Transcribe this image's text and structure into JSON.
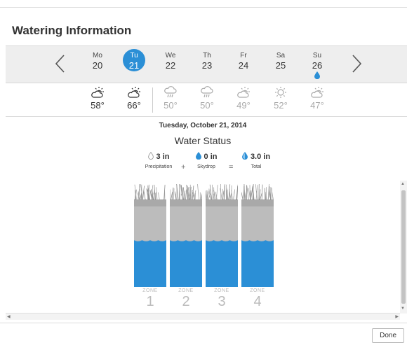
{
  "header": {
    "title": "Watering Information"
  },
  "days": [
    {
      "name": "Mo",
      "num": "20",
      "selected": false,
      "water": false
    },
    {
      "name": "Tu",
      "num": "21",
      "selected": true,
      "water": false
    },
    {
      "name": "We",
      "num": "22",
      "selected": false,
      "water": false
    },
    {
      "name": "Th",
      "num": "23",
      "selected": false,
      "water": false
    },
    {
      "name": "Fr",
      "num": "24",
      "selected": false,
      "water": false
    },
    {
      "name": "Sa",
      "num": "25",
      "selected": false,
      "water": false
    },
    {
      "name": "Su",
      "num": "26",
      "selected": false,
      "water": true
    }
  ],
  "forecast": [
    {
      "icon": "partly-sunny-icon",
      "temp": "58°",
      "past": true
    },
    {
      "icon": "partly-sunny-icon",
      "temp": "66°",
      "past": true
    },
    {
      "icon": "rain-icon",
      "temp": "50°",
      "past": false
    },
    {
      "icon": "rain-icon",
      "temp": "50°",
      "past": false
    },
    {
      "icon": "partly-sunny-icon",
      "temp": "49°",
      "past": false
    },
    {
      "icon": "sunny-icon",
      "temp": "52°",
      "past": false
    },
    {
      "icon": "partly-sunny-icon",
      "temp": "47°",
      "past": false
    }
  ],
  "status": {
    "date": "Tuesday, October 21, 2014",
    "title": "Water Status",
    "precipitation": {
      "value": "3 in",
      "label": "Precipitation"
    },
    "skydrop": {
      "value": "0 in",
      "label": "Skydrop"
    },
    "total": {
      "value": "3.0 in",
      "label": "Total"
    },
    "plus": "+",
    "equals": "="
  },
  "zones": [
    {
      "label": "ZONE",
      "num": "1",
      "water_level": 0.55
    },
    {
      "label": "ZONE",
      "num": "2",
      "water_level": 0.55
    },
    {
      "label": "ZONE",
      "num": "3",
      "water_level": 0.55
    },
    {
      "label": "ZONE",
      "num": "4",
      "water_level": 0.55
    }
  ],
  "footer": {
    "done_label": "Done"
  },
  "colors": {
    "accent": "#2b8fd6",
    "water": "#2b8fd6",
    "soil": "#bdbdbd",
    "grass": "#999999"
  }
}
